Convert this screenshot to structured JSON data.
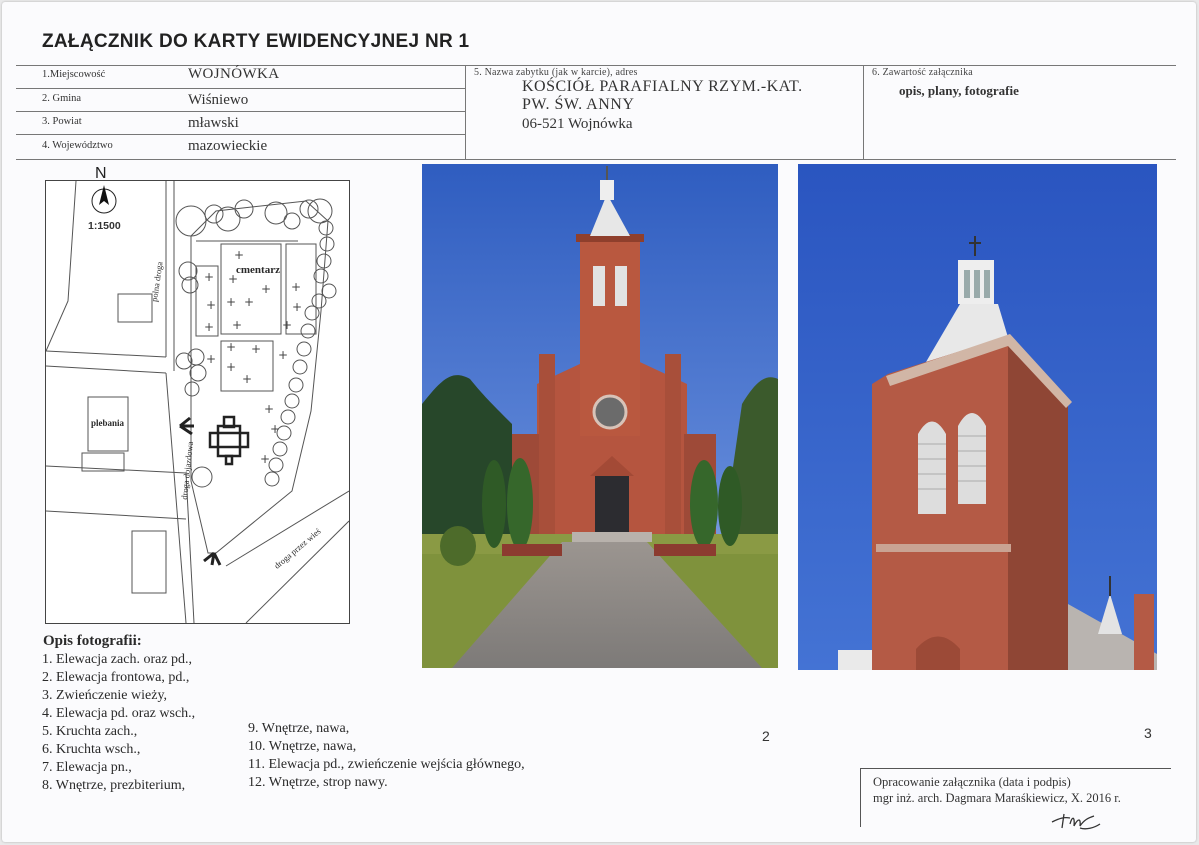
{
  "header": {
    "title": "ZAŁĄCZNIK DO KARTY EWIDENCYJNEJ NR 1"
  },
  "location": {
    "fields": [
      {
        "label": "1.Miejscowość",
        "value": "WOJNÓWKA"
      },
      {
        "label": "2. Gmina",
        "value": "Wiśniewo"
      },
      {
        "label": "3. Powiat",
        "value": "mławski"
      },
      {
        "label": "4. Województwo",
        "value": "mazowieckie"
      }
    ]
  },
  "monument": {
    "label": "5. Nazwa zabytku (jak w karcie), adres",
    "name_line1": "KOŚCIÓŁ PARAFIALNY RZYM.-KAT.",
    "name_line2": "PW. ŚW. ANNY",
    "address": "06-521 Wojnówka"
  },
  "attachment": {
    "label": "6. Zawartość załącznika",
    "contents": "opis, plany, fotografie"
  },
  "map": {
    "north": "N",
    "scale": "1:1500",
    "cemetery": "cmentarz",
    "rectory": "plebania",
    "field_road": "polna droga",
    "access_road": "droga dojazdowa",
    "village_road": "droga przez wieś"
  },
  "photos": {
    "icons": [
      "church-facade-photo",
      "church-tower-photo"
    ],
    "numbers": [
      "2",
      "3"
    ]
  },
  "captions": {
    "title": "Opis fotografii:",
    "items": [
      "1. Elewacja zach. oraz pd.,",
      "2. Elewacja frontowa, pd.,",
      "3. Zwieńczenie wieży,",
      "4. Elewacja pd. oraz wsch.,",
      "5. Kruchta zach.,",
      "6. Kruchta wsch.,",
      "7. Elewacja pn.,",
      "8. Wnętrze, prezbiterium,",
      "9. Wnętrze, nawa,",
      "10. Wnętrze, nawa,",
      "11. Elewacja pd.,  zwieńczenie wejścia głównego,",
      "12. Wnętrze, strop nawy."
    ]
  },
  "prepared": {
    "label": "Opracowanie załącznika (data i podpis)",
    "value": "mgr inż. arch. Dagmara Maraśkiewicz, X. 2016 r.",
    "signature": "signature-icon"
  },
  "colors": {
    "sky": "#3e69c8",
    "brick": "#b5553f",
    "grass": "#8a9a44",
    "paving": "#8b8787"
  }
}
